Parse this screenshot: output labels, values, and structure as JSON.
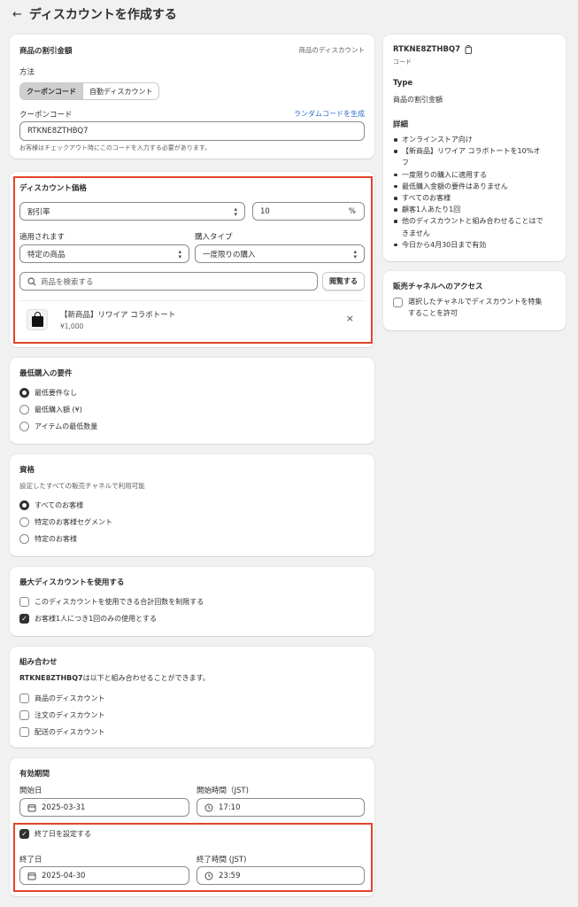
{
  "header": {
    "back": "←",
    "title": "ディスカウントを作成する"
  },
  "method_card": {
    "title": "商品の割引金額",
    "tag": "商品のディスカウント",
    "method_label": "方法",
    "methods": [
      "クーポンコード",
      "自動ディスカウント"
    ],
    "code_label": "クーポンコード",
    "random_link": "ランダムコードを生成",
    "code_value": "RTKNE8ZTHBQ7",
    "hint": "お客様はチェックアウト時にこのコードを入力する必要があります。"
  },
  "value_card": {
    "title": "ディスカウント価格",
    "type_select": "割引率",
    "percent_value": "10",
    "percent_suffix": "%",
    "applies_label": "適用されます",
    "applies_value": "特定の商品",
    "purchase_type_label": "購入タイプ",
    "purchase_type_value": "一度限りの購入",
    "search_placeholder": "商品を検索する",
    "browse_button": "閲覧する",
    "product": {
      "name": "【新商品】リワイア コラボトート",
      "price": "¥1,000",
      "remove": "×"
    }
  },
  "min_card": {
    "title": "最低購入の要件",
    "options": [
      "最低要件なし",
      "最低購入額 (¥)",
      "アイテムの最低数量"
    ]
  },
  "eligibility_card": {
    "title": "資格",
    "sub": "設定したすべての販売チャネルで利用可能",
    "options": [
      "すべてのお客様",
      "特定のお客様セグメント",
      "特定のお客様"
    ]
  },
  "max_card": {
    "title": "最大ディスカウントを使用する",
    "options": [
      "このディスカウントを使用できる合計回数を制限する",
      "お客様1人につき1回のみの使用とする"
    ]
  },
  "combo_card": {
    "title": "組み合わせ",
    "code_bold": "RTKNE8ZTHBQ7",
    "desc_rest": "は以下と組み合わせることができます。",
    "options": [
      "商品のディスカウント",
      "注文のディスカウント",
      "配送のディスカウント"
    ]
  },
  "period_card": {
    "title": "有効期間",
    "start_date_label": "開始日",
    "start_date": "2025-03-31",
    "start_time_label": "開始時間（JST)",
    "start_time": "17:10",
    "end_check_label": "終了日を設定する",
    "end_date_label": "終了日",
    "end_date": "2025-04-30",
    "end_time_label": "終了時間 (JST)",
    "end_time": "23:59"
  },
  "summary_card": {
    "code": "RTKNE8ZTHBQ7",
    "code_sub": "コード",
    "type_title": "Type",
    "type_value": "商品の割引金額",
    "details_title": "詳細",
    "details": [
      "オンラインストア向け",
      "【新商品】リワイア コラボトートを10%オ",
      "フ",
      "一度限りの購入に適用する",
      "最低購入金額の要件はありません",
      "すべてのお客様",
      "顧客1人あたり1回",
      "他のディスカウントと組み合わせることはで",
      "きません",
      "今日から4月30日まで有効"
    ]
  },
  "channel_card": {
    "title": "販売チャネルへのアクセス",
    "option_line1": "選択したチャネルでディスカウントを特集",
    "option_line2": "することを許可"
  }
}
